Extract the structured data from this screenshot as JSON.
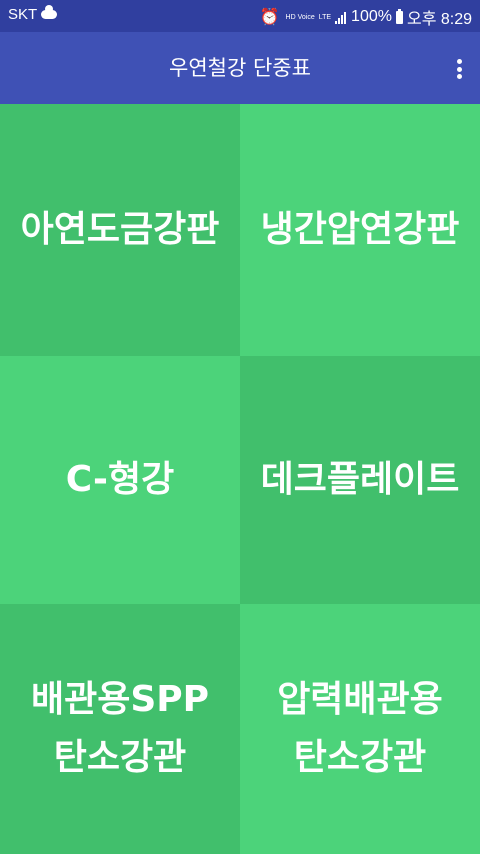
{
  "status_bar": {
    "carrier": "SKT",
    "hd_voice": "HD Voice",
    "lte": "LTE",
    "battery": "100%",
    "time": "오후 8:29"
  },
  "app_bar": {
    "title": "우연철강 단중표",
    "menu_icon": "more-vert-icon"
  },
  "colors": {
    "status_bar": "#303f9f",
    "app_bar": "#3f51b5",
    "tile_light": "#4cd37a",
    "tile_dark": "#41bf6c",
    "text": "#ffffff"
  },
  "tiles": [
    {
      "label": "아연도금강판"
    },
    {
      "label": "냉간압연강판"
    },
    {
      "label": "C-형강"
    },
    {
      "label": "데크플레이트"
    },
    {
      "label": "배관용SPP 탄소강관",
      "line1": "배관용SPP",
      "line2": "탄소강관"
    },
    {
      "label": "압력배관용 탄소강관",
      "line1": "압력배관용",
      "line2": "탄소강관"
    }
  ]
}
